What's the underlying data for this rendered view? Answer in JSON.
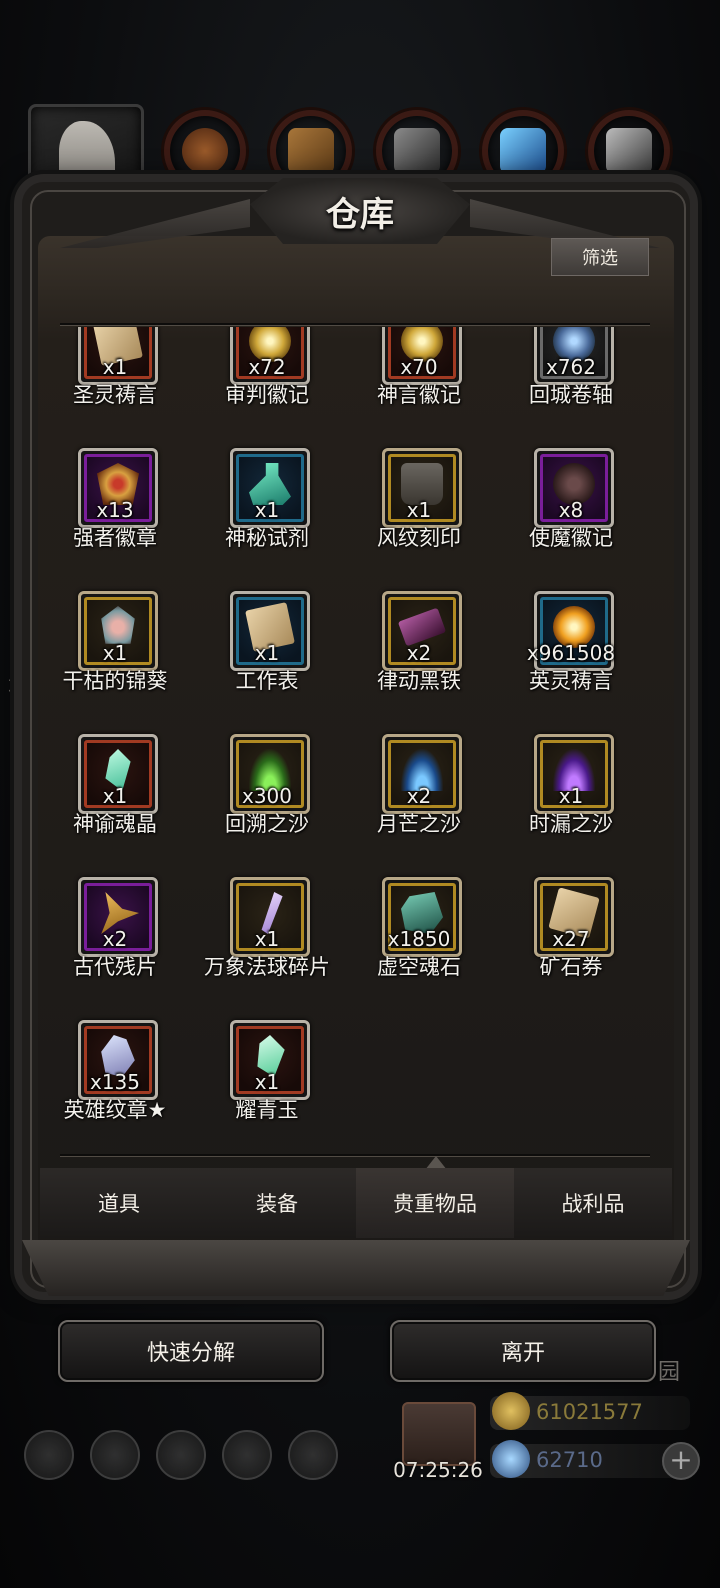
{
  "window": {
    "title": "仓库",
    "filter_label": "筛选"
  },
  "items": [
    {
      "name": "圣灵祷言",
      "qty": "x1",
      "rarity": "red",
      "icon": "scroll-icon"
    },
    {
      "name": "审判徽记",
      "qty": "x72",
      "rarity": "red",
      "icon": "judgment-emblem-icon"
    },
    {
      "name": "神言徽记",
      "qty": "x70",
      "rarity": "red",
      "icon": "divine-emblem-icon"
    },
    {
      "name": "回城卷轴",
      "qty": "x762",
      "rarity": "gray",
      "icon": "return-scroll-icon"
    },
    {
      "name": "强者徽章",
      "qty": "x13",
      "rarity": "purple",
      "icon": "champion-badge-icon"
    },
    {
      "name": "神秘试剂",
      "qty": "x1",
      "rarity": "blue",
      "icon": "potion-icon"
    },
    {
      "name": "风纹刻印",
      "qty": "x1",
      "rarity": "gold",
      "icon": "rune-stone-icon"
    },
    {
      "name": "使魔徽记",
      "qty": "x8",
      "rarity": "purple",
      "icon": "familiar-emblem-icon"
    },
    {
      "name": "干枯的锦葵",
      "qty": "x1",
      "rarity": "gold",
      "icon": "dried-mallow-icon"
    },
    {
      "name": "工作表",
      "qty": "x1",
      "rarity": "blue",
      "icon": "worksheet-icon"
    },
    {
      "name": "律动黑铁",
      "qty": "x2",
      "rarity": "gold",
      "icon": "black-iron-icon"
    },
    {
      "name": "英灵祷言",
      "qty": "x961508",
      "rarity": "blue",
      "icon": "golden-orb-icon"
    },
    {
      "name": "神谕魂晶",
      "qty": "x1",
      "rarity": "red",
      "icon": "soul-crystal-icon"
    },
    {
      "name": "回溯之沙",
      "qty": "x300",
      "rarity": "gold",
      "icon": "green-sand-icon"
    },
    {
      "name": "月芒之沙",
      "qty": "x2",
      "rarity": "gold",
      "icon": "blue-sand-icon"
    },
    {
      "name": "时漏之沙",
      "qty": "x1",
      "rarity": "gold",
      "icon": "purple-sand-icon"
    },
    {
      "name": "古代残片",
      "qty": "x2",
      "rarity": "purple",
      "icon": "ancient-fragment-icon"
    },
    {
      "name": "万象法球碎片",
      "qty": "x1",
      "rarity": "gold",
      "icon": "orb-shard-icon"
    },
    {
      "name": "虚空魂石",
      "qty": "x1850",
      "rarity": "gold",
      "icon": "void-soulstone-icon"
    },
    {
      "name": "矿石券",
      "qty": "x27",
      "rarity": "gold",
      "icon": "ore-ticket-icon"
    },
    {
      "name": "英雄纹章★",
      "qty": "x135",
      "rarity": "red",
      "icon": "hero-crest-icon"
    },
    {
      "name": "耀青玉",
      "qty": "x1",
      "rarity": "red",
      "icon": "jade-icon"
    }
  ],
  "tabs": [
    {
      "label": "道具",
      "active": false
    },
    {
      "label": "装备",
      "active": false
    },
    {
      "label": "贵重物品",
      "active": true
    },
    {
      "label": "战利品",
      "active": false
    }
  ],
  "actions": {
    "decompose": "快速分解",
    "leave": "离开"
  },
  "hud": {
    "timer": "07:25:26",
    "gold": "61021577",
    "gems": "62710",
    "side_text_left": "城",
    "side_text_right": "园"
  },
  "colors": {
    "gold": "#b08a22",
    "red": "#a13a22",
    "purple": "#7a1e9a",
    "blue": "#1f6a8a",
    "gray": "#6a6a6a",
    "gold_currency": "#8a7a3a",
    "gem_currency": "#5a6a8a"
  }
}
